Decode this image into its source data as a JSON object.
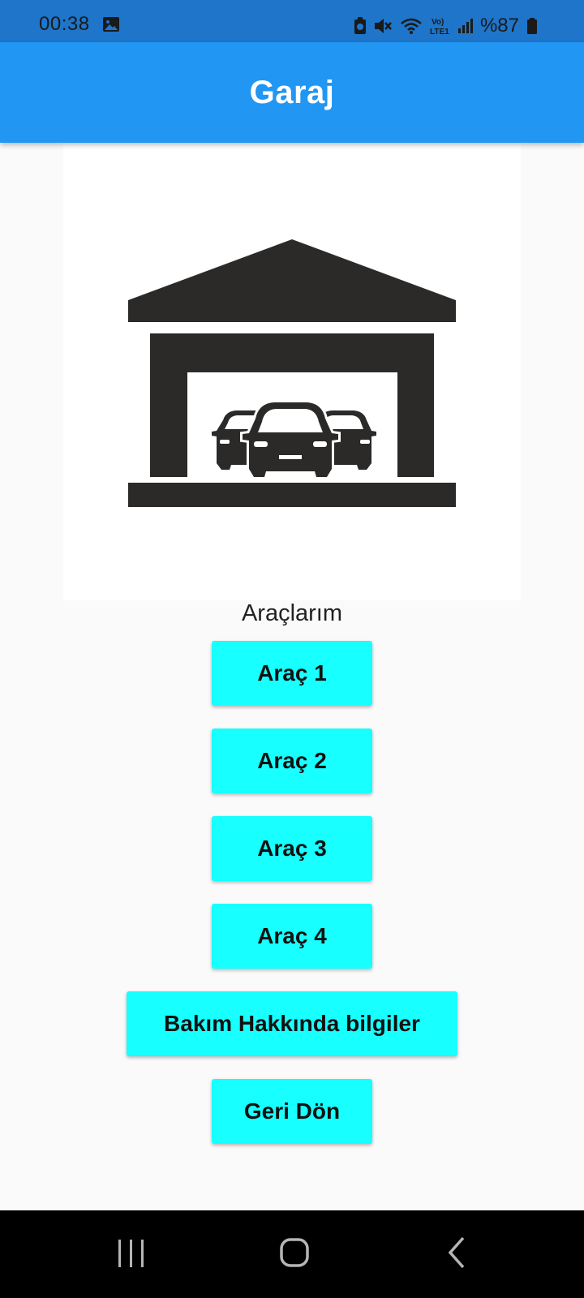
{
  "status_bar": {
    "time": "00:38",
    "battery_text": "%87",
    "icons": [
      "gallery-icon",
      "battery-saver-icon",
      "mute-icon",
      "wifi-icon",
      "volte-icon",
      "signal-icon",
      "battery-icon"
    ],
    "network_label_top": "Vo)",
    "network_label_bottom": "LTE1"
  },
  "app_bar": {
    "title": "Garaj"
  },
  "main": {
    "image_icon": "garage-with-cars-icon",
    "section_label": "Araçlarım",
    "buttons": [
      {
        "label": "Araç 1"
      },
      {
        "label": "Araç 2"
      },
      {
        "label": "Araç 3"
      },
      {
        "label": "Araç 4"
      },
      {
        "label": "Bakım Hakkında bilgiler"
      },
      {
        "label": "Geri Dön"
      }
    ]
  },
  "nav_bar": {
    "icons": [
      "recents-icon",
      "home-icon",
      "back-icon"
    ]
  },
  "colors": {
    "status_bar": "#1e75c9",
    "app_bar": "#2196f3",
    "button": "#18ffff",
    "background": "#fafafa",
    "nav_bar": "#000000"
  }
}
